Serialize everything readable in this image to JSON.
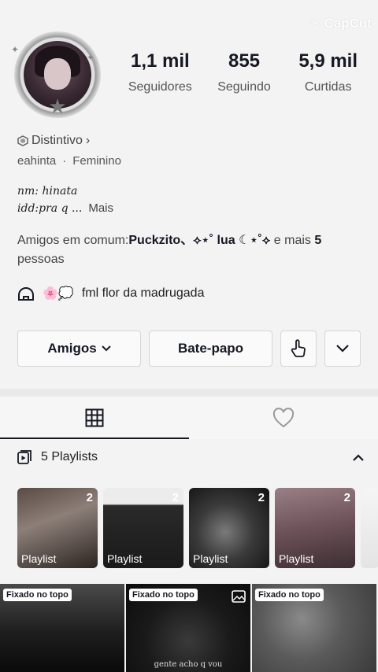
{
  "watermark": {
    "text": "CapCut"
  },
  "profile": {
    "stats": [
      {
        "value": "1,1 mil",
        "label": "Seguidores"
      },
      {
        "value": "855",
        "label": "Seguindo"
      },
      {
        "value": "5,9 mil",
        "label": "Curtidas"
      }
    ],
    "badge_label": "Distintivo",
    "username": "eahinta",
    "gender": "Feminino",
    "bio_line1": "nm: hinata",
    "bio_line2": "idd:pra q ...",
    "bio_more": "Mais",
    "friends_prefix": "Amigos em comum:",
    "friends_names": "Puckzito、⟡⋆˚ lua ☾⋆˚⟡",
    "friends_mid": " e mais ",
    "friends_count": "5",
    "friends_suffix": "pessoas",
    "status_emoji": "🌸💭",
    "status_text": "fml flor da madrugada"
  },
  "actions": {
    "friends_button": "Amigos",
    "chat_button": "Bate-papo"
  },
  "playlists": {
    "label": "5 Playlists",
    "items": [
      {
        "count": "2",
        "label": "Playlist"
      },
      {
        "count": "2",
        "label": "Playlist"
      },
      {
        "count": "2",
        "label": "Playlist"
      },
      {
        "count": "2",
        "label": "Playlist"
      }
    ]
  },
  "videos": [
    {
      "pinned": "Fixado no topo",
      "caption": ""
    },
    {
      "pinned": "Fixado no topo",
      "caption": "gente acho q vou"
    },
    {
      "pinned": "Fixado no topo",
      "caption": ""
    }
  ],
  "icons": {
    "grid": "grid-icon",
    "heart": "heart-icon",
    "playlist": "playlist-icon",
    "collapse": "chevron-up-icon"
  }
}
